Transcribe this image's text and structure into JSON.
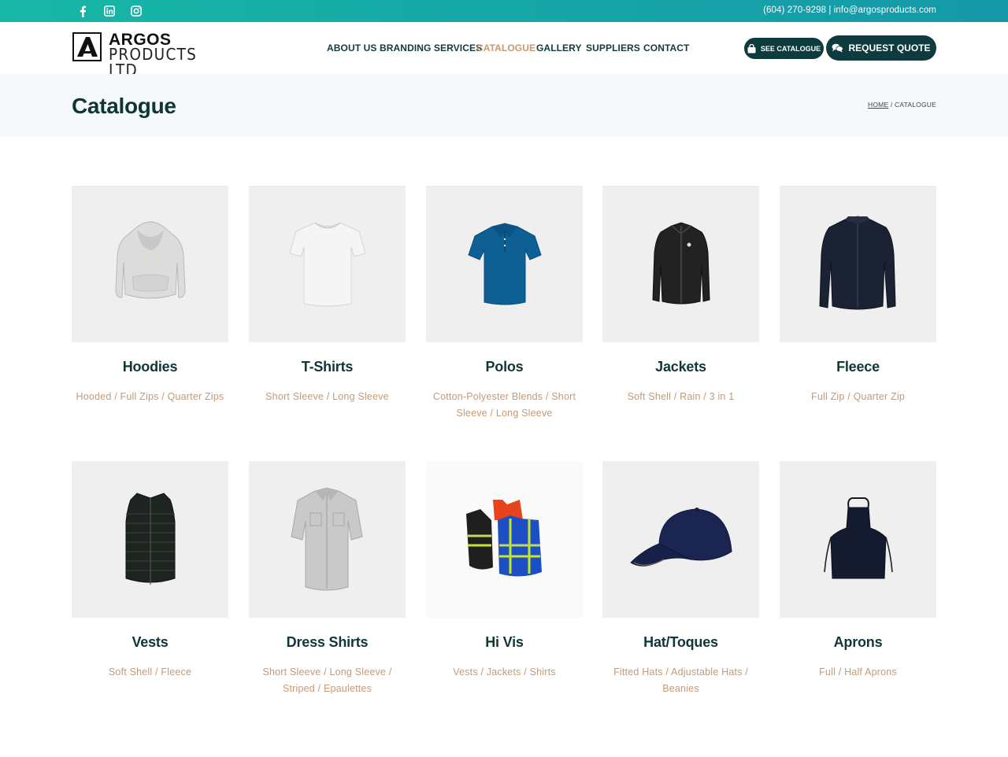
{
  "topbar": {
    "social_icons": [
      "facebook-icon",
      "linkedin-icon",
      "instagram-icon"
    ],
    "contact": "(604) 270-9298 | info@argosproducts.com"
  },
  "header": {
    "logo_line1": "ARGOS",
    "logo_line2": "PRODUCTS LTD",
    "nav": [
      {
        "label": "ABOUT US",
        "active": false
      },
      {
        "label": "BRANDING SERVICES",
        "active": false
      },
      {
        "label": "CATALOGUE",
        "active": true
      },
      {
        "label": "GALLERY",
        "active": false
      },
      {
        "label": "SUPPLIERS",
        "active": false
      },
      {
        "label": "CONTACT",
        "active": false
      }
    ],
    "see_catalogue": "SEE CATALOGUE",
    "request_quote": "REQUEST QUOTE"
  },
  "title_section": {
    "title": "Catalogue",
    "breadcrumb_home": "HOME",
    "breadcrumb_sep": " / ",
    "breadcrumb_current": "CATALOGUE"
  },
  "categories": [
    {
      "title": "Hoodies",
      "sub": "Hooded / Full Zips / Quarter Zips",
      "icon": "hoodie-icon"
    },
    {
      "title": "T-Shirts",
      "sub": "Short Sleeve / Long Sleeve",
      "icon": "tshirt-icon"
    },
    {
      "title": "Polos",
      "sub": "Cotton-Polyester Blends / Short Sleeve / Long Sleeve",
      "icon": "polo-icon"
    },
    {
      "title": "Jackets",
      "sub": "Soft Shell / Rain / 3 in 1",
      "icon": "jacket-icon"
    },
    {
      "title": "Fleece",
      "sub": "Full Zip / Quarter Zip",
      "icon": "fleece-icon"
    },
    {
      "title": "Vests",
      "sub": "Soft Shell / Fleece",
      "icon": "vest-icon"
    },
    {
      "title": "Dress Shirts",
      "sub": "Short Sleeve / Long Sleeve / Striped / Epaulettes",
      "icon": "dress-shirt-icon"
    },
    {
      "title": "Hi Vis",
      "sub": "Vests / Jackets / Shirts",
      "icon": "hi-vis-icon"
    },
    {
      "title": "Hat/Toques",
      "sub": "Fitted Hats / Adjustable Hats / Beanies",
      "icon": "hat-icon"
    },
    {
      "title": "Aprons",
      "sub": "Full / Half Aprons",
      "icon": "apron-icon"
    }
  ],
  "colors": {
    "brand_dark": "#0e3b3e",
    "accent_tan": "#c59a76",
    "topbar_start": "#17b7a6",
    "topbar_end": "#1598a8"
  }
}
